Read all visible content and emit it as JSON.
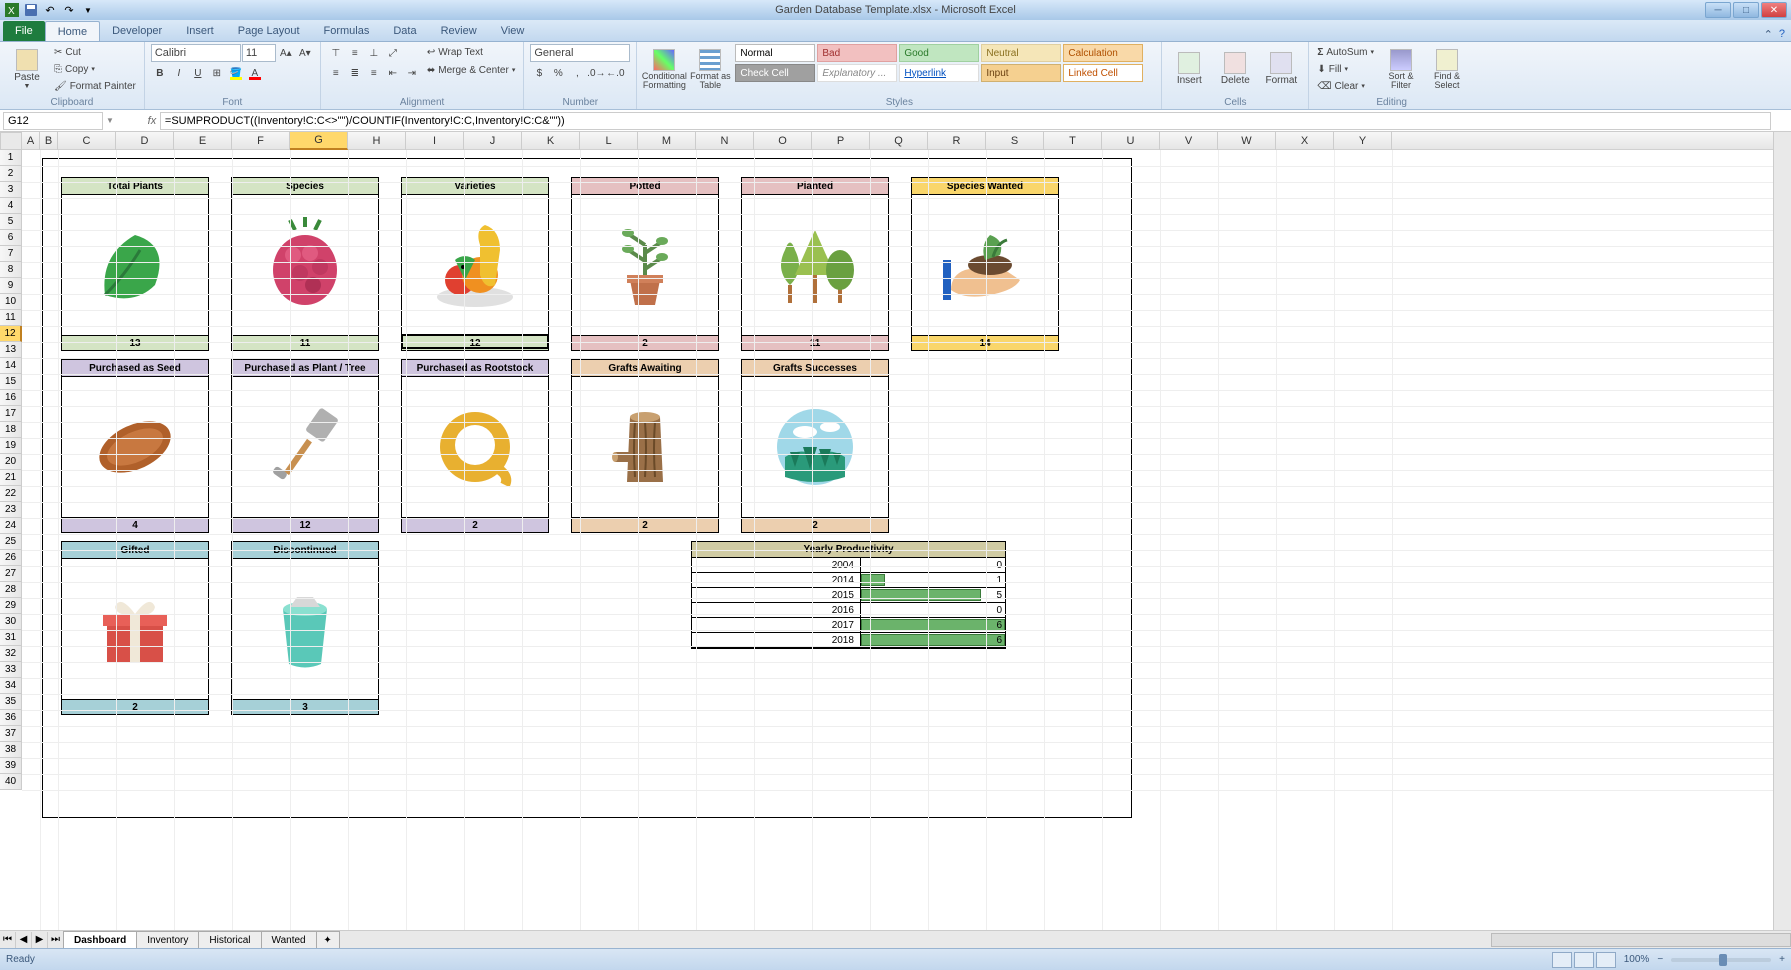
{
  "window": {
    "title": "Garden Database Template.xlsx - Microsoft Excel"
  },
  "tabs": {
    "file": "File",
    "items": [
      "Home",
      "Developer",
      "Insert",
      "Page Layout",
      "Formulas",
      "Data",
      "Review",
      "View"
    ],
    "active": "Home"
  },
  "ribbon": {
    "clipboard": {
      "label": "Clipboard",
      "paste": "Paste",
      "cut": "Cut",
      "copy": "Copy",
      "painter": "Format Painter"
    },
    "font": {
      "label": "Font",
      "name": "Calibri",
      "size": "11"
    },
    "alignment": {
      "label": "Alignment",
      "wrap": "Wrap Text",
      "merge": "Merge & Center"
    },
    "number": {
      "label": "Number",
      "format": "General"
    },
    "styles": {
      "label": "Styles",
      "cond": "Conditional Formatting",
      "table": "Format as Table",
      "gallery": [
        {
          "t": "Normal",
          "bg": "#fff",
          "c": "#000",
          "bd": "#bbb"
        },
        {
          "t": "Bad",
          "bg": "#f2c0c0",
          "c": "#a03030",
          "bd": "#e0a0a0"
        },
        {
          "t": "Good",
          "bg": "#c0e6c0",
          "c": "#2a7a2a",
          "bd": "#a0d0a0"
        },
        {
          "t": "Neutral",
          "bg": "#f5e6b8",
          "c": "#8a7020",
          "bd": "#e0cfa0"
        },
        {
          "t": "Calculation",
          "bg": "#f9d9a8",
          "c": "#b05000",
          "bd": "#e0b060"
        },
        {
          "t": "Check Cell",
          "bg": "#a0a0a0",
          "c": "#fff",
          "bd": "#888"
        },
        {
          "t": "Explanatory ...",
          "bg": "#fff",
          "c": "#888",
          "bd": "#ddd",
          "i": true
        },
        {
          "t": "Hyperlink",
          "bg": "#fff",
          "c": "#0050c0",
          "bd": "#ddd",
          "u": true
        },
        {
          "t": "Input",
          "bg": "#f5d090",
          "c": "#6a4010",
          "bd": "#d0b070"
        },
        {
          "t": "Linked Cell",
          "bg": "#fff",
          "c": "#c05000",
          "bd": "#e0b060"
        }
      ]
    },
    "cells": {
      "label": "Cells",
      "insert": "Insert",
      "delete": "Delete",
      "format": "Format"
    },
    "editing": {
      "label": "Editing",
      "autosum": "AutoSum",
      "fill": "Fill",
      "clear": "Clear",
      "sort": "Sort & Filter",
      "find": "Find & Select"
    }
  },
  "formula": {
    "cell": "G12",
    "text": "=SUMPRODUCT((Inventory!C:C<>\"\")/COUNTIF(Inventory!C:C,Inventory!C:C&\"\"))"
  },
  "columns": [
    "A",
    "B",
    "C",
    "D",
    "E",
    "F",
    "G",
    "H",
    "I",
    "J",
    "K",
    "L",
    "M",
    "N",
    "O",
    "P",
    "Q",
    "R",
    "S",
    "T",
    "U",
    "V",
    "W",
    "X",
    "Y"
  ],
  "col_widths": {
    "A": 18,
    "B": 18,
    "default": 58,
    "dash": 148
  },
  "rows": 40,
  "selected_row": 12,
  "selected_col": "G",
  "dashboard": {
    "row1": [
      {
        "title": "Total Plants",
        "value": "13",
        "color": "head-green",
        "icon": "leaf"
      },
      {
        "title": "Species",
        "value": "11",
        "color": "head-green",
        "icon": "berry"
      },
      {
        "title": "Varieties",
        "value": "12",
        "color": "head-green",
        "icon": "fruit",
        "selected": true
      },
      {
        "title": "Potted",
        "value": "2",
        "color": "head-pink",
        "icon": "pot"
      },
      {
        "title": "Planted",
        "value": "11",
        "color": "head-pink",
        "icon": "trees"
      },
      {
        "title": "Species Wanted",
        "value": "14",
        "color": "head-yellow",
        "icon": "hand"
      }
    ],
    "row2": [
      {
        "title": "Purchased as Seed",
        "value": "4",
        "color": "head-lav",
        "icon": "seed"
      },
      {
        "title": "Purchased as Plant / Tree",
        "value": "12",
        "color": "head-lav",
        "icon": "spade"
      },
      {
        "title": "Purchased as Rootstock",
        "value": "2",
        "color": "head-lav",
        "icon": "root"
      },
      {
        "title": "Grafts Awaiting",
        "value": "2",
        "color": "head-peach",
        "icon": "log"
      },
      {
        "title": "Grafts Successes",
        "value": "2",
        "color": "head-peach",
        "icon": "forest"
      }
    ],
    "row3": [
      {
        "title": "Gifted",
        "value": "2",
        "color": "head-teal",
        "icon": "gift"
      },
      {
        "title": "Discontinued",
        "value": "3",
        "color": "head-teal",
        "icon": "trash"
      }
    ],
    "productivity": {
      "title": "Yearly Productivity",
      "rows": [
        {
          "year": "2004",
          "value": "0",
          "bar": 0
        },
        {
          "year": "2014",
          "value": "1",
          "bar": 17
        },
        {
          "year": "2015",
          "value": "5",
          "bar": 83
        },
        {
          "year": "2016",
          "value": "0",
          "bar": 0
        },
        {
          "year": "2017",
          "value": "6",
          "bar": 100
        },
        {
          "year": "2018",
          "value": "6",
          "bar": 100
        }
      ]
    }
  },
  "sheets": {
    "items": [
      "Dashboard",
      "Inventory",
      "Historical",
      "Wanted"
    ],
    "active": "Dashboard"
  },
  "status": {
    "ready": "Ready",
    "zoom": "100%"
  }
}
